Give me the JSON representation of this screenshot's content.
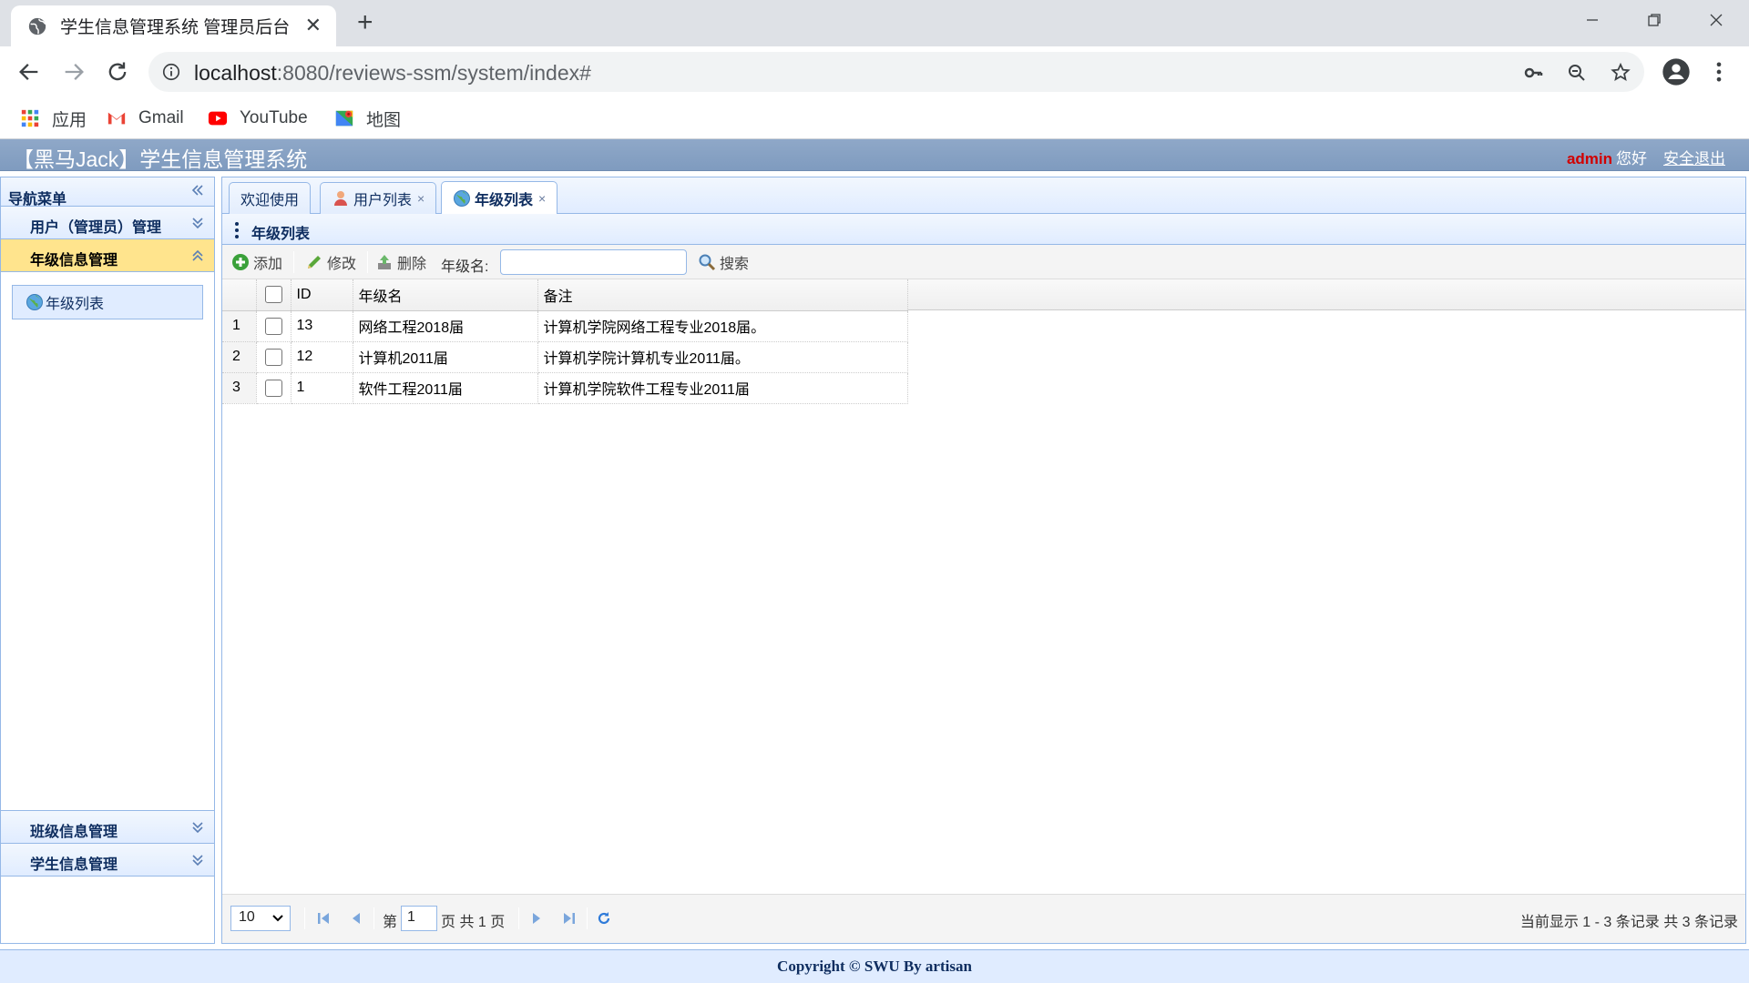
{
  "browser": {
    "tab_title": "学生信息管理系统 管理员后台",
    "url_host": "localhost",
    "url_rest": ":8080/reviews-ssm/system/index#",
    "bookmarks": [
      {
        "label": "应用",
        "icon": "apps-grid-icon"
      },
      {
        "label": "Gmail",
        "icon": "gmail-icon"
      },
      {
        "label": "YouTube",
        "icon": "youtube-icon"
      },
      {
        "label": "地图",
        "icon": "maps-icon"
      }
    ]
  },
  "header": {
    "title": "【黑马Jack】学生信息管理系统",
    "user": "admin",
    "greeting": "您好",
    "logout": "安全退出",
    "user_color": "#d10000"
  },
  "sidebar": {
    "title": "导航菜单",
    "sections": [
      {
        "label": "用户（管理员）管理",
        "expanded": false
      },
      {
        "label": "年级信息管理",
        "expanded": true,
        "items": [
          {
            "label": "年级列表",
            "icon": "globe-icon"
          }
        ]
      },
      {
        "label": "班级信息管理",
        "expanded": false
      },
      {
        "label": "学生信息管理",
        "expanded": false
      }
    ]
  },
  "tabs": [
    {
      "label": "欢迎使用",
      "closable": false
    },
    {
      "label": "用户列表",
      "closable": true,
      "icon": "user-icon"
    },
    {
      "label": "年级列表",
      "closable": true,
      "icon": "globe-icon",
      "active": true
    }
  ],
  "tab_close_glyph": "×",
  "panel": {
    "title": "年级列表",
    "toolbar": {
      "add": "添加",
      "edit": "修改",
      "delete": "删除",
      "search_label": "年级名:",
      "search_value": "",
      "search_button": "搜索"
    },
    "columns": [
      "ID",
      "年级名",
      "备注"
    ],
    "rows": [
      {
        "num": "1",
        "id": "13",
        "name": "网络工程2018届",
        "remark": "计算机学院网络工程专业2018届。"
      },
      {
        "num": "2",
        "id": "12",
        "name": "计算机2011届",
        "remark": "计算机学院计算机专业2011届。"
      },
      {
        "num": "3",
        "id": "1",
        "name": "软件工程2011届",
        "remark": "计算机学院软件工程专业2011届"
      }
    ],
    "pager": {
      "page_size": "10",
      "page_prefix": "第",
      "page_number": "1",
      "page_suffix": "页 共 1 页",
      "info": "当前显示 1 - 3 条记录 共 3 条记录"
    }
  },
  "footer": {
    "text": "Copyright © SWU By artisan"
  },
  "colors": {
    "accent": "#95b8e7",
    "header_bg": "#7f9bbf",
    "selected_section": "#ffe48d"
  }
}
